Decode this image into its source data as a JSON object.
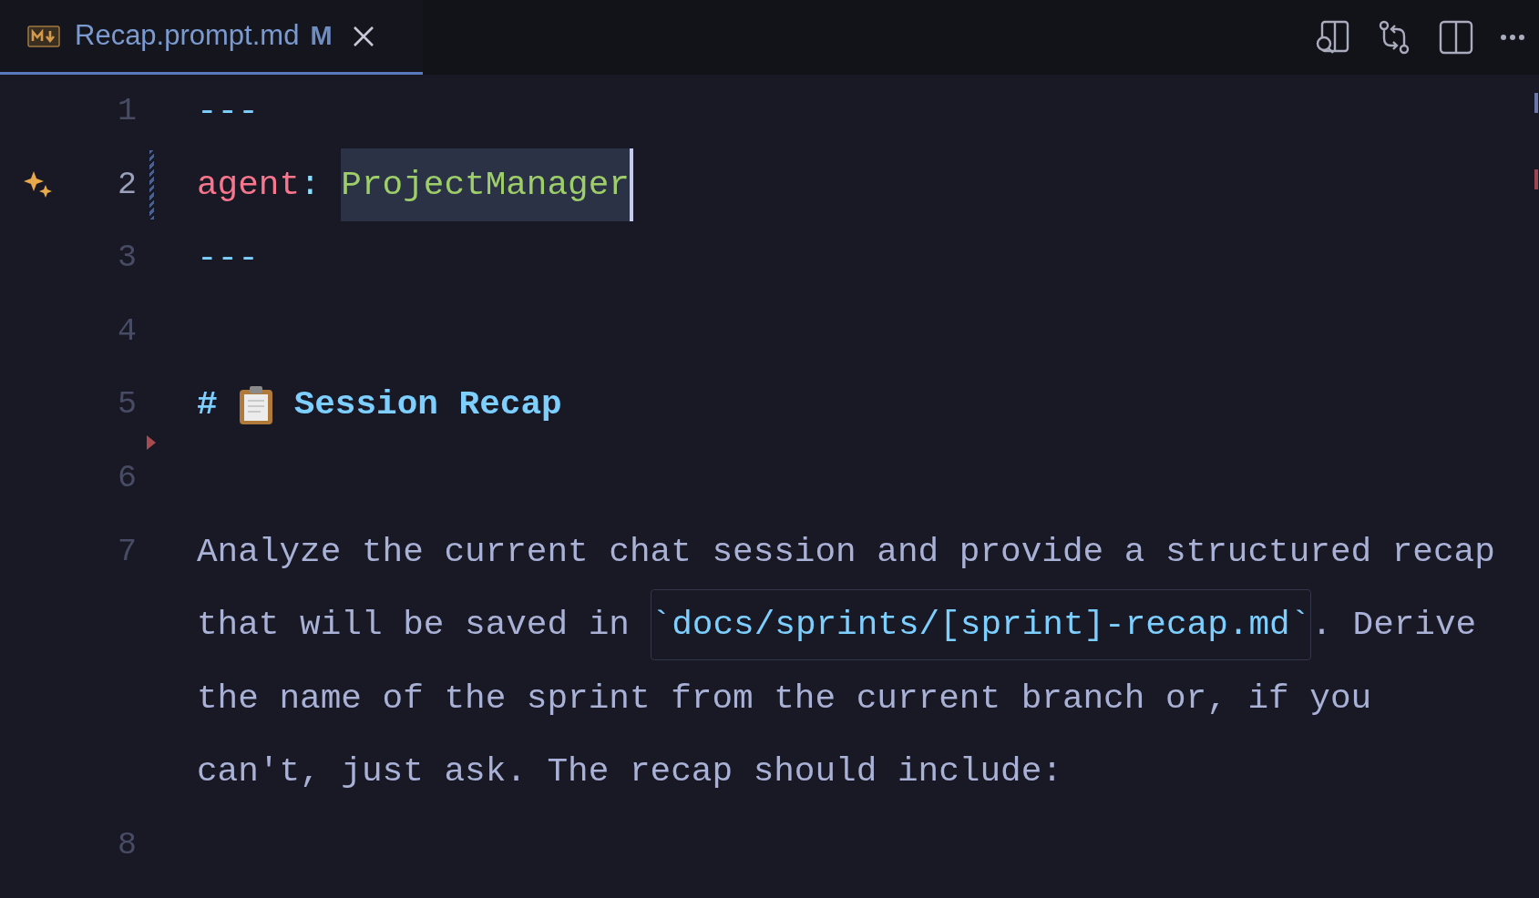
{
  "tab": {
    "title": "Recap.prompt.md",
    "status": "M",
    "selected": true
  },
  "editor": {
    "lines": [
      {
        "number": "1",
        "active": false,
        "rows": [
          [
            {
              "kind": "punct",
              "text": "---"
            }
          ]
        ]
      },
      {
        "number": "2",
        "active": true,
        "modified": true,
        "ai_suggestion": true,
        "rows": [
          [
            {
              "kind": "key",
              "text": "agent"
            },
            {
              "kind": "colon",
              "text": ": "
            },
            {
              "kind": "value",
              "text": "ProjectManager",
              "selected": true
            }
          ]
        ]
      },
      {
        "number": "3",
        "active": false,
        "rows": [
          [
            {
              "kind": "punct",
              "text": "---"
            }
          ]
        ]
      },
      {
        "number": "4",
        "active": false,
        "rows": [
          []
        ]
      },
      {
        "number": "5",
        "active": false,
        "deleted_after": true,
        "rows": [
          [
            {
              "kind": "heading",
              "text": "#"
            },
            {
              "kind": "clipboard"
            },
            {
              "kind": "heading",
              "text": "Session Recap"
            }
          ]
        ]
      },
      {
        "number": "6",
        "active": false,
        "rows": [
          []
        ]
      },
      {
        "number": "7",
        "active": false,
        "rows": [
          [
            {
              "kind": "text",
              "text": "Analyze the current chat session and provide a structured recap"
            }
          ],
          [
            {
              "kind": "text",
              "text": "that will be saved in "
            },
            {
              "kind": "code",
              "text": "`docs/sprints/[sprint]-recap.md`"
            },
            {
              "kind": "text",
              "text": ". Derive"
            }
          ],
          [
            {
              "kind": "text",
              "text": "the name of the sprint from the current branch or, if you"
            }
          ],
          [
            {
              "kind": "text",
              "text": "can't, just ask. The recap should include:"
            }
          ]
        ]
      },
      {
        "number": "8",
        "active": false,
        "rows": [
          []
        ]
      }
    ]
  }
}
